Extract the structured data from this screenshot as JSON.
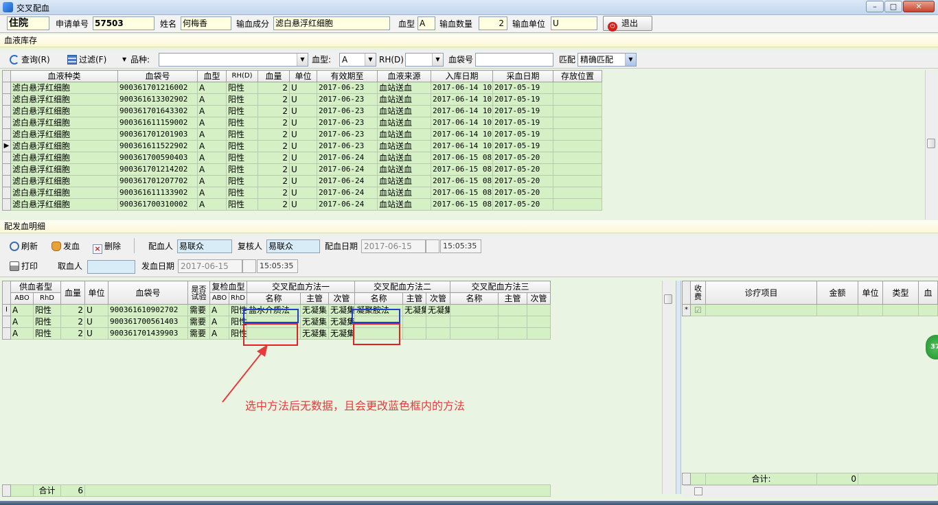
{
  "window": {
    "title": "交叉配血",
    "min": "–",
    "max": "□",
    "close": "✕"
  },
  "header": {
    "dept": "住院",
    "req_label": "申请单号",
    "req_value": "57503",
    "name_label": "姓名",
    "name_value": "何梅香",
    "component_label": "输血成分",
    "component_value": "滤白悬浮红细胞",
    "bloodtype_label": "血型",
    "bloodtype_value": "A",
    "qty_label": "输血数量",
    "qty_value": "2",
    "unit_label": "输血单位",
    "unit_value": "U",
    "exit_label": "退出"
  },
  "inventory": {
    "section_title": "血液库存",
    "query_label": "查询(R)",
    "filter_label": "过滤(F)",
    "variety_label": "品种:",
    "bloodtype_label": "血型:",
    "bloodtype_value": "A",
    "rh_label": "RH(D)",
    "bag_label": "血袋号",
    "match_label": "匹配",
    "match_value": "精确匹配",
    "columns": [
      "血液种类",
      "血袋号",
      "血型",
      "RH(D)",
      "血量",
      "单位",
      "有效期至",
      "血液来源",
      "入库日期",
      "采血日期",
      "存放位置"
    ],
    "rows": [
      [
        "滤白悬浮红细胞",
        "900361701216002",
        "A",
        "阳性",
        "2",
        "U",
        "2017-06-23",
        "血站送血",
        "2017-06-14 10",
        "2017-05-19",
        ""
      ],
      [
        "滤白悬浮红细胞",
        "900361613302902",
        "A",
        "阳性",
        "2",
        "U",
        "2017-06-23",
        "血站送血",
        "2017-06-14 10",
        "2017-05-19",
        ""
      ],
      [
        "滤白悬浮红细胞",
        "900361701643302",
        "A",
        "阳性",
        "2",
        "U",
        "2017-06-23",
        "血站送血",
        "2017-06-14 10",
        "2017-05-19",
        ""
      ],
      [
        "滤白悬浮红细胞",
        "900361611159002",
        "A",
        "阳性",
        "2",
        "U",
        "2017-06-23",
        "血站送血",
        "2017-06-14 10",
        "2017-05-19",
        ""
      ],
      [
        "滤白悬浮红细胞",
        "900361701201903",
        "A",
        "阳性",
        "2",
        "U",
        "2017-06-23",
        "血站送血",
        "2017-06-14 10",
        "2017-05-19",
        ""
      ],
      [
        "滤白悬浮红细胞",
        "900361611522902",
        "A",
        "阳性",
        "2",
        "U",
        "2017-06-23",
        "血站送血",
        "2017-06-14 10",
        "2017-05-19",
        ""
      ],
      [
        "滤白悬浮红细胞",
        "900361700590403",
        "A",
        "阳性",
        "2",
        "U",
        "2017-06-24",
        "血站送血",
        "2017-06-15 08",
        "2017-05-20",
        ""
      ],
      [
        "滤白悬浮红细胞",
        "900361701214202",
        "A",
        "阳性",
        "2",
        "U",
        "2017-06-24",
        "血站送血",
        "2017-06-15 08",
        "2017-05-20",
        ""
      ],
      [
        "滤白悬浮红细胞",
        "900361701207702",
        "A",
        "阳性",
        "2",
        "U",
        "2017-06-24",
        "血站送血",
        "2017-06-15 08",
        "2017-05-20",
        ""
      ],
      [
        "滤白悬浮红细胞",
        "900361611133902",
        "A",
        "阳性",
        "2",
        "U",
        "2017-06-24",
        "血站送血",
        "2017-06-15 08",
        "2017-05-20",
        ""
      ],
      [
        "滤白悬浮红细胞",
        "900361700310002",
        "A",
        "阳性",
        "2",
        "U",
        "2017-06-24",
        "血站送血",
        "2017-06-15 08",
        "2017-05-20",
        ""
      ]
    ],
    "current_row_marker": "▶"
  },
  "dispatch": {
    "section_title": "配发血明细",
    "refresh_label": "刷新",
    "send_label": "发血",
    "delete_label": "删除",
    "matcher_label": "配血人",
    "matcher_value": "易联众",
    "reviewer_label": "复核人",
    "reviewer_value": "易联众",
    "match_date_label": "配血日期",
    "match_date_value": "2017-06-15",
    "match_time_value": "15:05:35",
    "print_label": "打印",
    "taker_label": "取血人",
    "taker_value": "",
    "send_date_label": "发血日期",
    "send_date_value": "2017-06-15",
    "send_time_value": "15:05:35"
  },
  "detail": {
    "group_donor": "供血者型",
    "group_recheck": "复检血型",
    "group_m1": "交叉配血方法一",
    "group_m2": "交叉配血方法二",
    "group_m3": "交叉配血方法三",
    "col_abo": "ABO",
    "col_rhd": "RhD",
    "col_volume": "血量",
    "col_unit": "单位",
    "col_bag": "血袋号",
    "col_test": "是否试验",
    "col_name": "名称",
    "col_major": "主管",
    "col_minor": "次管",
    "rows": [
      {
        "marker": "I",
        "abo": "A",
        "rhd": "阳性",
        "vol": "2",
        "unit": "U",
        "bag": "900361610902702",
        "test": "需要",
        "rabo": "A",
        "rrhd": "阳性",
        "m1": "盐水介质法",
        "m1a": "无凝集",
        "m1b": "无凝集",
        "m2": "凝聚胺法",
        "m2a": "无凝集",
        "m2b": "无凝集",
        "m3": "",
        "m3a": "",
        "m3b": ""
      },
      {
        "marker": "",
        "abo": "A",
        "rhd": "阳性",
        "vol": "2",
        "unit": "U",
        "bag": "900361700561403",
        "test": "需要",
        "rabo": "A",
        "rrhd": "阳性",
        "m1": "",
        "m1a": "无凝集",
        "m1b": "无凝集",
        "m2": "",
        "m2a": "",
        "m2b": "",
        "m3": "",
        "m3a": "",
        "m3b": ""
      },
      {
        "marker": "",
        "abo": "A",
        "rhd": "阳性",
        "vol": "2",
        "unit": "U",
        "bag": "900361701439903",
        "test": "需要",
        "rabo": "A",
        "rrhd": "阳性",
        "m1": "",
        "m1a": "无凝集",
        "m1b": "无凝集",
        "m2": "",
        "m2a": "",
        "m2b": "",
        "m3": "",
        "m3a": "",
        "m3b": ""
      }
    ],
    "total_label": "合计",
    "total_value": "6"
  },
  "fees": {
    "col_charge": "收费",
    "col_item": "诊疗项目",
    "col_amount": "金额",
    "col_unit": "单位",
    "col_type": "类型",
    "col_blood": "血",
    "new_row_marker": "*",
    "total_label": "合计:",
    "total_value": "0",
    "badge": "37"
  },
  "annotation": {
    "text": "选中方法后无数据，且会更改蓝色框内的方法",
    "color": "#e83a3a"
  }
}
